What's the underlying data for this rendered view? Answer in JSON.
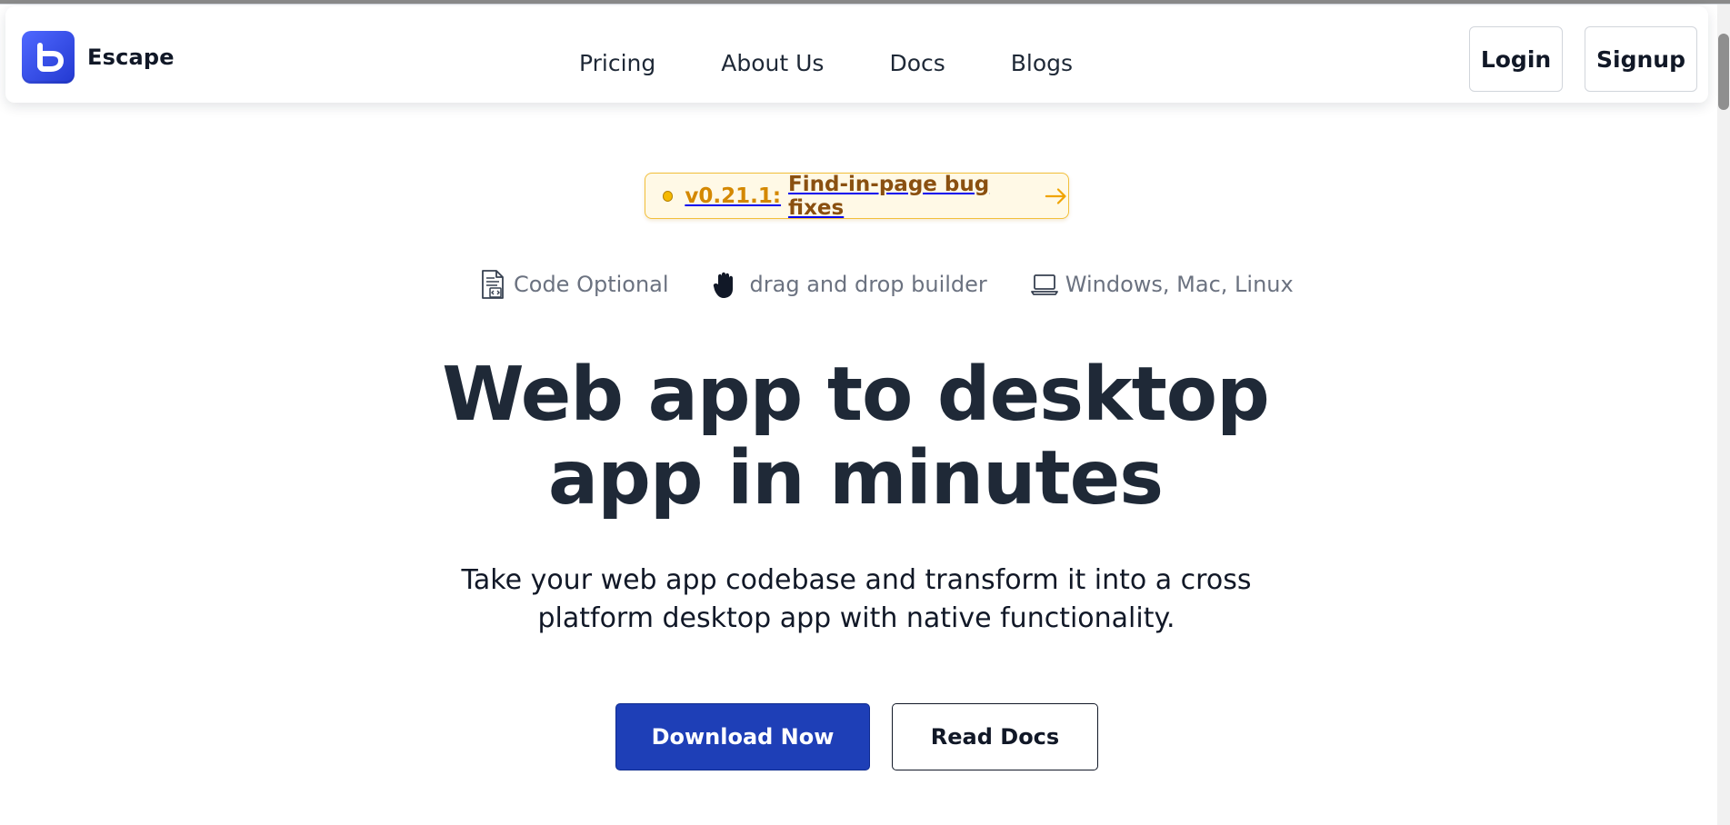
{
  "brand": {
    "name": "Escape",
    "logo_icon": "escape-logo-icon",
    "logo_colors": [
      "#4f68ff",
      "#2339d1"
    ]
  },
  "navigation": {
    "links": [
      {
        "label": "Pricing"
      },
      {
        "label": "About Us"
      },
      {
        "label": "Docs"
      },
      {
        "label": "Blogs"
      }
    ],
    "login_label": "Login",
    "signup_label": "Signup"
  },
  "release": {
    "version": "v0.21.1:",
    "text": "Find-in-page bug fixes",
    "arrow_icon": "arrow-right-icon",
    "accent_color": "#f5b900"
  },
  "features": [
    {
      "icon": "code-document-icon",
      "label": "Code Optional"
    },
    {
      "icon": "hand-icon",
      "label": "drag and drop builder"
    },
    {
      "icon": "laptop-icon",
      "label": "Windows, Mac, Linux"
    }
  ],
  "hero": {
    "title_line_1": "Web app to desktop",
    "title_line_2": "app in minutes",
    "subtitle": "Take your web app codebase and transform it into a cross platform desktop app with native functionality."
  },
  "actions": {
    "primary_label": "Download Now",
    "secondary_label": "Read Docs",
    "primary_color": "#1e3fb7"
  }
}
